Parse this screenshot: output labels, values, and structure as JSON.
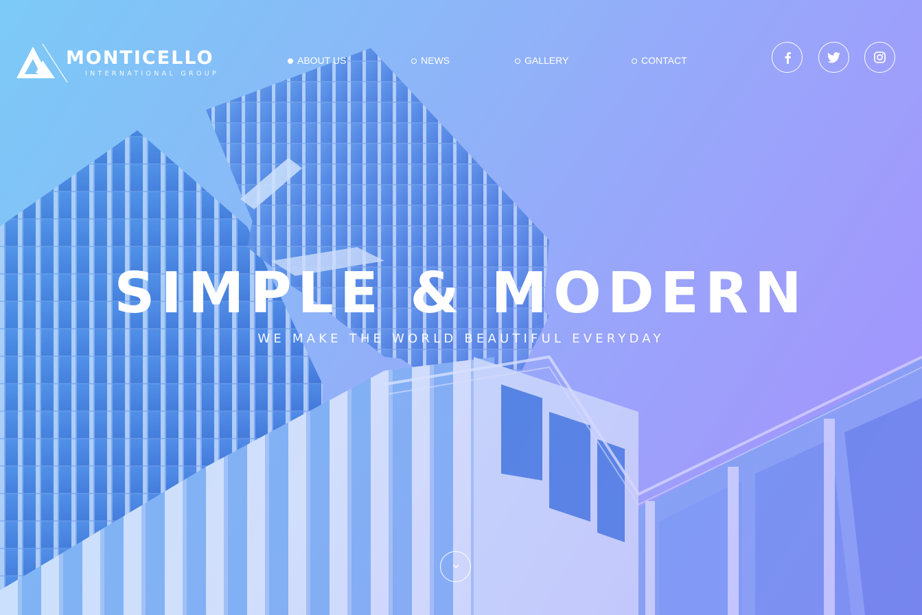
{
  "brand": {
    "name": "MONTICELLO",
    "tagline": "INTERNATIONAL GROUP"
  },
  "nav": {
    "items": [
      {
        "label": "ABOUT US",
        "active": true
      },
      {
        "label": "NEWS",
        "active": false
      },
      {
        "label": "GALLERY",
        "active": false
      },
      {
        "label": "CONTACT",
        "active": false
      }
    ]
  },
  "social": [
    {
      "icon": "facebook-icon"
    },
    {
      "icon": "twitter-icon"
    },
    {
      "icon": "instagram-icon"
    }
  ],
  "hero": {
    "title": "SIMPLE & MODERN",
    "subtitle": "WE MAKE THE WORLD BEAUTIFUL EVERYDAY",
    "scroll_icon": "chevron-down-icon"
  },
  "colors": {
    "gradient_start": "#7ecbf5",
    "gradient_end": "#a393fb",
    "text": "#ffffff"
  }
}
